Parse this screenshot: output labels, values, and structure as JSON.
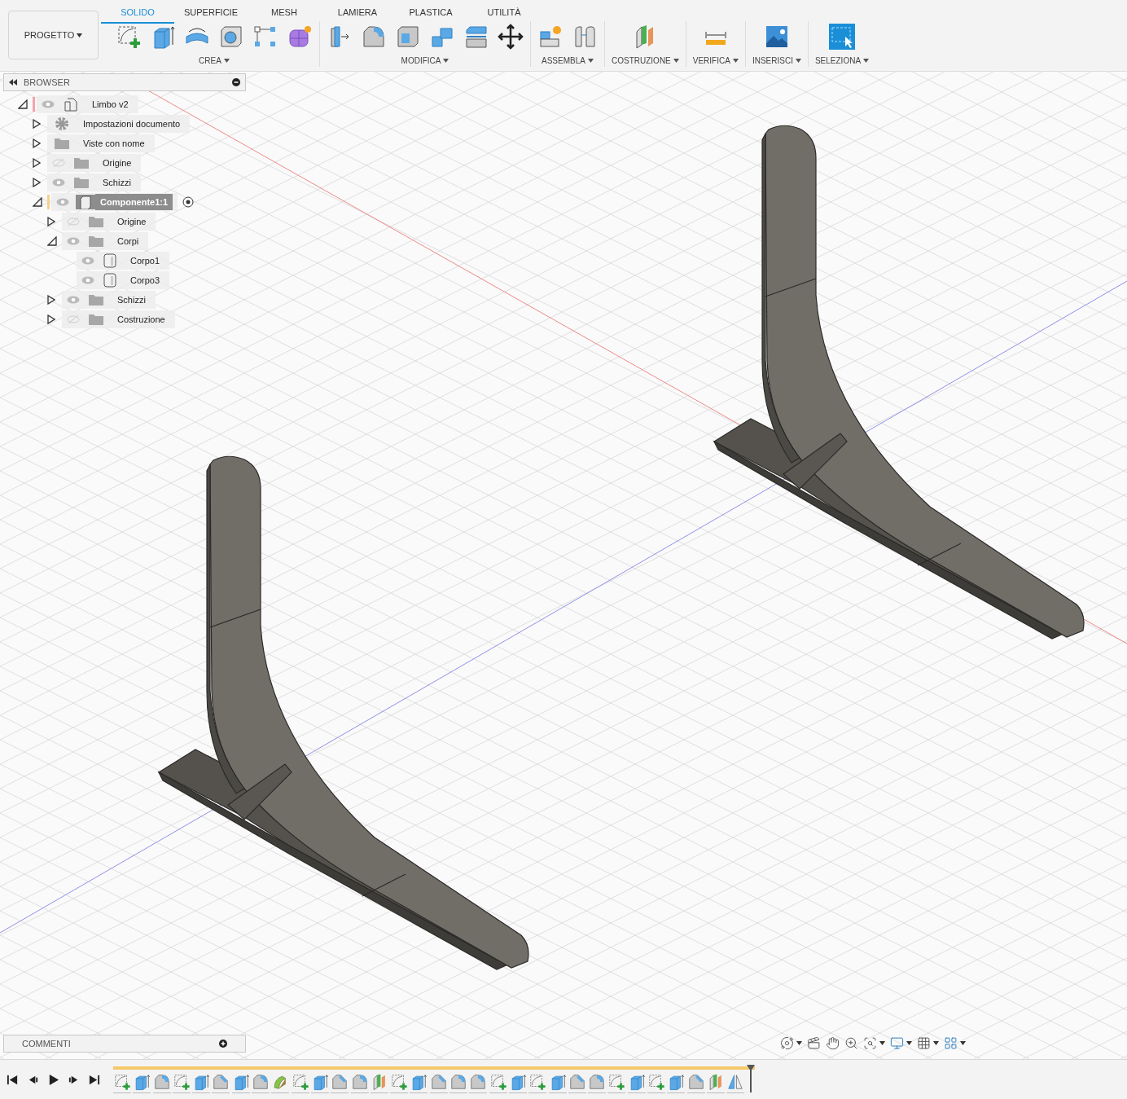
{
  "toolbar": {
    "project_button": "PROGETTO",
    "tabs": [
      {
        "label": "SOLIDO",
        "selected": true
      },
      {
        "label": "SUPERFICIE",
        "selected": false
      },
      {
        "label": "MESH",
        "selected": false
      },
      {
        "label": "LAMIERA",
        "selected": false
      },
      {
        "label": "PLASTICA",
        "selected": false
      },
      {
        "label": "UTILITÀ",
        "selected": false
      }
    ],
    "groups": [
      {
        "label": "CREA",
        "tools": [
          {
            "kind": "sketch"
          },
          {
            "kind": "extrude"
          },
          {
            "kind": "revolve"
          },
          {
            "kind": "hole"
          },
          {
            "kind": "pattern"
          },
          {
            "kind": "form"
          }
        ]
      },
      {
        "label": "MODIFICA",
        "tools": [
          {
            "kind": "presspull"
          },
          {
            "kind": "fillet"
          },
          {
            "kind": "shell"
          },
          {
            "kind": "combine"
          },
          {
            "kind": "offset"
          },
          {
            "kind": "move"
          }
        ]
      },
      {
        "label": "ASSEMBLA",
        "tools": [
          {
            "kind": "component"
          },
          {
            "kind": "joint"
          }
        ]
      },
      {
        "label": "COSTRUZIONE",
        "tools": [
          {
            "kind": "plane"
          }
        ]
      },
      {
        "label": "VERIFICA",
        "tools": [
          {
            "kind": "measure"
          }
        ]
      },
      {
        "label": "INSERISCI",
        "tools": [
          {
            "kind": "image"
          }
        ]
      },
      {
        "label": "SELEZIONA",
        "tools": [
          {
            "kind": "select"
          }
        ]
      }
    ]
  },
  "browser": {
    "title": "BROWSER",
    "tree": [
      {
        "label": "Limbo v2",
        "kind": "document",
        "visible": true,
        "expanded": true,
        "selected": false,
        "color": "#f4a3a8",
        "children": [
          {
            "label": "Impostazioni documento",
            "kind": "settings",
            "expanded": false,
            "selected": false
          },
          {
            "label": "Viste con nome",
            "kind": "folder",
            "expanded": false,
            "selected": false
          },
          {
            "label": "Origine",
            "kind": "folder",
            "visible": false,
            "expanded": false,
            "selected": false
          },
          {
            "label": "Schizzi",
            "kind": "folder",
            "visible": true,
            "expanded": false,
            "selected": false
          },
          {
            "label": "Componente1:1",
            "kind": "component",
            "visible": true,
            "expanded": true,
            "selected": true,
            "active": true,
            "color": "#f5d28a",
            "children": [
              {
                "label": "Origine",
                "kind": "folder",
                "visible": false,
                "expanded": false,
                "selected": false
              },
              {
                "label": "Corpi",
                "kind": "folder",
                "visible": true,
                "expanded": true,
                "selected": false,
                "children": [
                  {
                    "label": "Corpo1",
                    "kind": "body",
                    "visible": true,
                    "selected": false
                  },
                  {
                    "label": "Corpo3",
                    "kind": "body",
                    "visible": true,
                    "selected": false
                  }
                ]
              },
              {
                "label": "Schizzi",
                "kind": "folder",
                "visible": true,
                "expanded": false,
                "selected": false
              },
              {
                "label": "Costruzione",
                "kind": "folder",
                "visible": false,
                "expanded": false,
                "selected": false
              }
            ]
          }
        ]
      }
    ]
  },
  "comments": {
    "title": "COMMENTI"
  },
  "navigation_tools": [
    {
      "kind": "orbit",
      "menu": true
    },
    {
      "kind": "look",
      "menu": false
    },
    {
      "kind": "pan",
      "menu": false
    },
    {
      "kind": "zoom",
      "menu": false
    },
    {
      "kind": "fit",
      "menu": true
    },
    {
      "kind": "display",
      "menu": true
    },
    {
      "kind": "grid",
      "menu": true
    },
    {
      "kind": "viewports",
      "menu": true
    }
  ],
  "timeline": {
    "controls": [
      {
        "kind": "first"
      },
      {
        "kind": "previous"
      },
      {
        "kind": "play"
      },
      {
        "kind": "next"
      },
      {
        "kind": "last"
      }
    ],
    "features": [
      {
        "kind": "sketch"
      },
      {
        "kind": "extrude"
      },
      {
        "kind": "fillet"
      },
      {
        "kind": "sketch"
      },
      {
        "kind": "extrude"
      },
      {
        "kind": "chamfer"
      },
      {
        "kind": "extrude"
      },
      {
        "kind": "fillet"
      },
      {
        "kind": "split"
      },
      {
        "kind": "sketch"
      },
      {
        "kind": "extrude"
      },
      {
        "kind": "chamfer"
      },
      {
        "kind": "fillet"
      },
      {
        "kind": "plane"
      },
      {
        "kind": "sketch"
      },
      {
        "kind": "extrude"
      },
      {
        "kind": "chamfer"
      },
      {
        "kind": "fillet"
      },
      {
        "kind": "fillet"
      },
      {
        "kind": "sketch"
      },
      {
        "kind": "extrude"
      },
      {
        "kind": "sketch"
      },
      {
        "kind": "extrude"
      },
      {
        "kind": "chamfer"
      },
      {
        "kind": "fillet"
      },
      {
        "kind": "sketch"
      },
      {
        "kind": "extrude"
      },
      {
        "kind": "sketch"
      },
      {
        "kind": "extrude"
      },
      {
        "kind": "chamfer"
      },
      {
        "kind": "plane"
      },
      {
        "kind": "mirror"
      }
    ]
  }
}
